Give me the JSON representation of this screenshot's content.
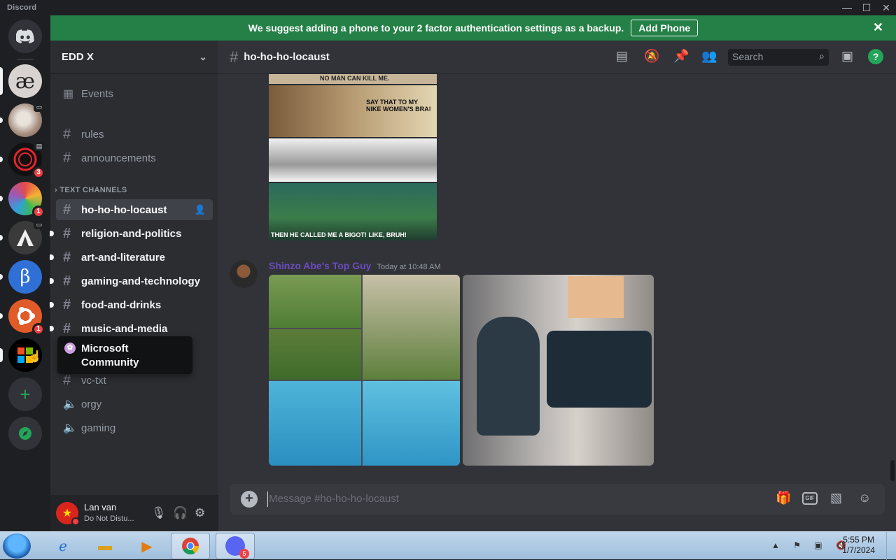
{
  "window": {
    "app_name": "Discord",
    "controls": [
      "—",
      "☐",
      "✕"
    ]
  },
  "banner": {
    "text": "We suggest adding a phone to your 2 factor authentication settings as a backup.",
    "button": "Add Phone",
    "close": "✕"
  },
  "servers": [
    {
      "name": "Home",
      "label": "",
      "badge": "",
      "color": "#5865f2"
    },
    {
      "name": "ae server",
      "label": "æ",
      "badge": "",
      "color": "#d8d3d0"
    },
    {
      "name": "cat server",
      "label": "",
      "badge": "",
      "color": "#a58d7e"
    },
    {
      "name": "red ring server",
      "label": "",
      "badge": "3",
      "color": "#111111"
    },
    {
      "name": "colorful server",
      "label": "",
      "badge": "1",
      "color": "#2ea3d8"
    },
    {
      "name": "mountain server",
      "label": "",
      "badge": "",
      "color": "#3a3a3a"
    },
    {
      "name": "beta server",
      "label": "β",
      "badge": "",
      "color": "#2f6fd6"
    },
    {
      "name": "ubuntu server",
      "label": "",
      "badge": "1",
      "color": "#e05b28"
    },
    {
      "name": "Microsoft Community",
      "label": "",
      "badge": "",
      "color": "#000000"
    }
  ],
  "sidebar": {
    "server_name": "EDD X",
    "events": "Events",
    "channels_top": [
      "rules",
      "announcements"
    ],
    "category": "TEXT CHANNELS",
    "text_channels": [
      {
        "name": "ho-ho-ho-locaust",
        "state": "active"
      },
      {
        "name": "religion-and-politics",
        "state": "unread"
      },
      {
        "name": "art-and-literature",
        "state": "unread"
      },
      {
        "name": "gaming-and-technology",
        "state": "unread"
      },
      {
        "name": "food-and-drinks",
        "state": "unread"
      },
      {
        "name": "music-and-media",
        "state": "unread"
      }
    ],
    "channels_bottom": [
      {
        "name": "vc-txt",
        "type": "text"
      },
      {
        "name": "orgy",
        "type": "voice"
      },
      {
        "name": "gaming",
        "type": "voice"
      }
    ],
    "tooltip": "Microsoft Community"
  },
  "user": {
    "name": "Lan van",
    "status": "Do Not Distu..."
  },
  "main": {
    "channel": "ho-ho-ho-locaust",
    "search_placeholder": "Search",
    "help": "?",
    "meme_captions": [
      "NO MAN CAN KILL ME.",
      "SAY THAT TO MY NIKE WOMEN'S BRA!",
      "THEN HE CALLED ME A BIGOT! LIKE, BRUH!"
    ],
    "author": "Shinzo Abe's Top Guy",
    "timestamp": "Today at 10:48 AM",
    "composer_placeholder": "Message #ho-ho-ho-locaust",
    "composer_gif": "GIF"
  },
  "taskbar": {
    "time": "5:55 PM",
    "date": "1/7/2024",
    "discord_badge": "5"
  }
}
